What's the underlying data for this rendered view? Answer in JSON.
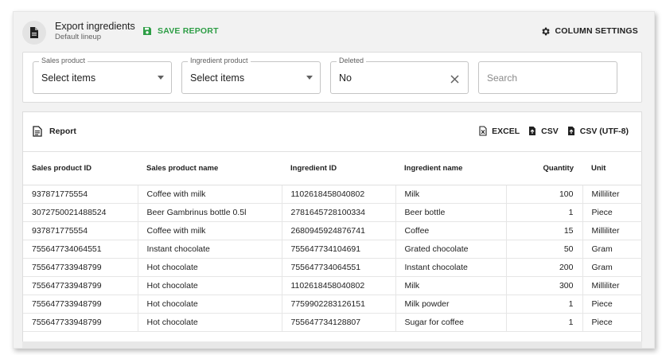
{
  "header": {
    "title": "Export ingredients",
    "subtitle": "Default lineup",
    "save_label": "SAVE REPORT",
    "column_settings_label": "COLUMN SETTINGS"
  },
  "filters": {
    "sales_product": {
      "label": "Sales product",
      "value": "Select items"
    },
    "ingredient_product": {
      "label": "Ingredient product",
      "value": "Select items"
    },
    "deleted": {
      "label": "Deleted",
      "value": "No"
    },
    "search": {
      "placeholder": "Search"
    }
  },
  "report": {
    "title": "Report",
    "exports": {
      "excel": "EXCEL",
      "csv": "CSV",
      "csv_utf8": "CSV (UTF-8)"
    },
    "columns": [
      "Sales product ID",
      "Sales product name",
      "Ingredient ID",
      "Ingredient name",
      "Quantity",
      "Unit"
    ],
    "rows": [
      [
        "937871775554",
        "Coffee with milk",
        "1102618458040802",
        "Milk",
        "100",
        "Milliliter"
      ],
      [
        "3072750021488524",
        "Beer Gambrinus bottle 0.5l",
        "2781645728100334",
        "Beer bottle",
        "1",
        "Piece"
      ],
      [
        "937871775554",
        "Coffee with milk",
        "2680945924876741",
        "Coffee",
        "15",
        "Milliliter"
      ],
      [
        "755647734064551",
        "Instant chocolate",
        "755647734104691",
        "Grated chocolate",
        "50",
        "Gram"
      ],
      [
        "755647733948799",
        "Hot chocolate",
        "755647734064551",
        "Instant chocolate",
        "200",
        "Gram"
      ],
      [
        "755647733948799",
        "Hot chocolate",
        "1102618458040802",
        "Milk",
        "300",
        "Milliliter"
      ],
      [
        "755647733948799",
        "Hot chocolate",
        "7759902283126151",
        "Milk powder",
        "1",
        "Piece"
      ],
      [
        "755647733948799",
        "Hot chocolate",
        "755647734128807",
        "Sugar for coffee",
        "1",
        "Piece"
      ]
    ]
  },
  "colors": {
    "accent_green": "#2e9e46",
    "text": "#212121",
    "muted": "#616161"
  }
}
